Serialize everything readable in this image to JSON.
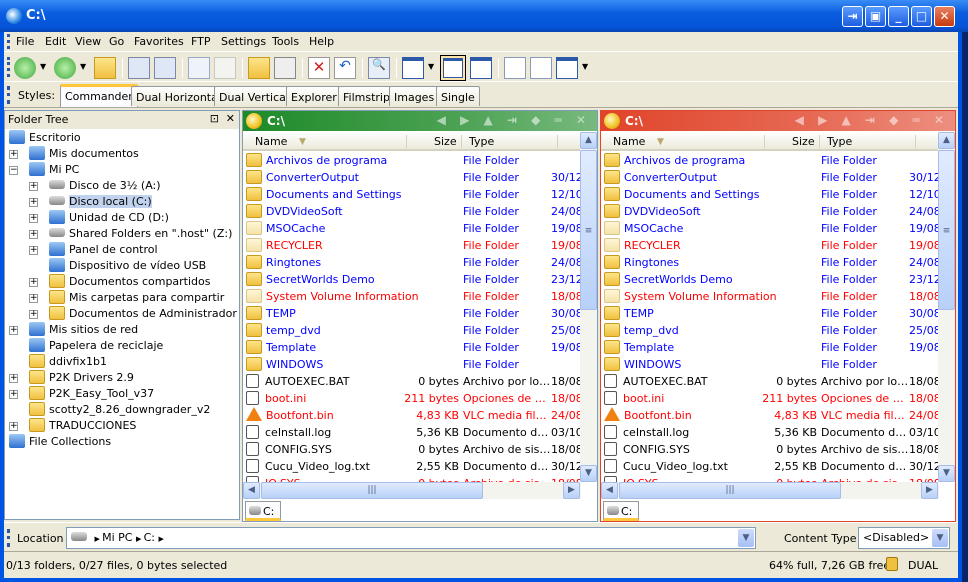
{
  "window": {
    "title": "C:\\"
  },
  "menu": [
    "File",
    "Edit",
    "View",
    "Go",
    "Favorites",
    "FTP",
    "Settings",
    "Tools",
    "Help"
  ],
  "styles": {
    "label": "Styles:",
    "tabs": [
      "Commander",
      "Dual Horizontal",
      "Dual Vertical",
      "Explorer",
      "Filmstrip",
      "Images",
      "Single"
    ],
    "active": "Commander"
  },
  "tree": {
    "title": "Folder Tree",
    "items": [
      {
        "label": "Escritorio",
        "level": 0,
        "exp": "",
        "icon": "desktop-icon"
      },
      {
        "label": "Mis documentos",
        "level": 1,
        "exp": "+",
        "icon": "documents-icon"
      },
      {
        "label": "Mi PC",
        "level": 1,
        "exp": "-",
        "icon": "computer-icon"
      },
      {
        "label": "Disco de 3½ (A:)",
        "level": 2,
        "exp": "+",
        "icon": "floppy-icon"
      },
      {
        "label": "Disco local (C:)",
        "level": 2,
        "exp": "+",
        "icon": "drive-icon",
        "selected": true
      },
      {
        "label": "Unidad de CD (D:)",
        "level": 2,
        "exp": "+",
        "icon": "cd-icon"
      },
      {
        "label": "Shared Folders en \".host\" (Z:)",
        "level": 2,
        "exp": "+",
        "icon": "network-drive-icon"
      },
      {
        "label": "Panel de control",
        "level": 2,
        "exp": "+",
        "icon": "control-panel-icon"
      },
      {
        "label": "Dispositivo de vídeo USB",
        "level": 2,
        "exp": "",
        "icon": "camera-icon"
      },
      {
        "label": "Documentos compartidos",
        "level": 2,
        "exp": "+",
        "icon": "folder-icon"
      },
      {
        "label": "Mis carpetas para compartir",
        "level": 2,
        "exp": "+",
        "icon": "shared-folder-icon"
      },
      {
        "label": "Documentos de Administrador",
        "level": 2,
        "exp": "+",
        "icon": "folder-icon"
      },
      {
        "label": "Mis sitios de red",
        "level": 1,
        "exp": "+",
        "icon": "network-icon"
      },
      {
        "label": "Papelera de reciclaje",
        "level": 1,
        "exp": "",
        "icon": "recycle-bin-icon"
      },
      {
        "label": "ddivfix1b1",
        "level": 1,
        "exp": "",
        "icon": "folder-icon"
      },
      {
        "label": "P2K Drivers 2.9",
        "level": 1,
        "exp": "+",
        "icon": "folder-icon"
      },
      {
        "label": "P2K_Easy_Tool_v37",
        "level": 1,
        "exp": "+",
        "icon": "folder-icon"
      },
      {
        "label": "scotty2_8.26_downgrader_v2",
        "level": 1,
        "exp": "",
        "icon": "folder-icon"
      },
      {
        "label": "TRADUCCIONES",
        "level": 1,
        "exp": "+",
        "icon": "folder-icon"
      },
      {
        "label": "File Collections",
        "level": 0,
        "exp": "",
        "icon": "collections-icon"
      }
    ]
  },
  "columns": {
    "name": "Name",
    "size": "Size",
    "type": "Type"
  },
  "panes": [
    {
      "title": "C:\\",
      "tab": "C:",
      "color": "#1e8a28"
    },
    {
      "title": "C:\\",
      "tab": "C:",
      "color": "#e0442a"
    }
  ],
  "files": [
    {
      "name": "Archivos de programa",
      "size": "",
      "type": "File Folder",
      "date": "",
      "kind": "folder",
      "color": "blue"
    },
    {
      "name": "ConverterOutput",
      "size": "",
      "type": "File Folder",
      "date": "30/12",
      "kind": "folder",
      "color": "blue"
    },
    {
      "name": "Documents and Settings",
      "size": "",
      "type": "File Folder",
      "date": "12/10",
      "kind": "folder",
      "color": "blue"
    },
    {
      "name": "DVDVideoSoft",
      "size": "",
      "type": "File Folder",
      "date": "24/08",
      "kind": "folder",
      "color": "blue"
    },
    {
      "name": "MSOCache",
      "size": "",
      "type": "File Folder",
      "date": "19/08",
      "kind": "folder-hidden",
      "color": "blue"
    },
    {
      "name": "RECYCLER",
      "size": "",
      "type": "File Folder",
      "date": "19/08",
      "kind": "folder-hidden",
      "color": "red"
    },
    {
      "name": "Ringtones",
      "size": "",
      "type": "File Folder",
      "date": "24/08",
      "kind": "folder",
      "color": "blue"
    },
    {
      "name": "SecretWorlds Demo",
      "size": "",
      "type": "File Folder",
      "date": "23/12",
      "kind": "folder",
      "color": "blue"
    },
    {
      "name": "System Volume Information",
      "size": "",
      "type": "File Folder",
      "date": "18/08",
      "kind": "folder-hidden",
      "color": "red"
    },
    {
      "name": "TEMP",
      "size": "",
      "type": "File Folder",
      "date": "30/08",
      "kind": "folder",
      "color": "blue"
    },
    {
      "name": "temp_dvd",
      "size": "",
      "type": "File Folder",
      "date": "25/08",
      "kind": "folder",
      "color": "blue"
    },
    {
      "name": "Template",
      "size": "",
      "type": "File Folder",
      "date": "19/08",
      "kind": "folder",
      "color": "blue"
    },
    {
      "name": "WINDOWS",
      "size": "",
      "type": "File Folder",
      "date": "",
      "kind": "folder",
      "color": "blue"
    },
    {
      "name": "AUTOEXEC.BAT",
      "size": "0 bytes",
      "type": "Archivo por lotes MS-DOS",
      "date": "18/08",
      "kind": "batch-file",
      "color": "black"
    },
    {
      "name": "boot.ini",
      "size": "211 bytes",
      "type": "Opciones de configuración",
      "date": "18/08",
      "kind": "ini-file",
      "color": "red"
    },
    {
      "name": "Bootfont.bin",
      "size": "4,83 KB",
      "type": "VLC media file (.bin)",
      "date": "24/08",
      "kind": "vlc-file",
      "color": "red"
    },
    {
      "name": "ceInstall.log",
      "size": "5,36 KB",
      "type": "Documento de texto",
      "date": "03/10",
      "kind": "text-file",
      "color": "black"
    },
    {
      "name": "CONFIG.SYS",
      "size": "0 bytes",
      "type": "Archivo de sistema",
      "date": "18/08",
      "kind": "sys-file",
      "color": "black"
    },
    {
      "name": "Cucu_Video_log.txt",
      "size": "2,55 KB",
      "type": "Documento de texto",
      "date": "30/12",
      "kind": "text-file",
      "color": "black"
    },
    {
      "name": "IO.SYS",
      "size": "0 bytes",
      "type": "Archivo de sistema",
      "date": "18/08",
      "kind": "sys-file",
      "color": "red"
    }
  ],
  "location": {
    "label": "Location",
    "path": [
      "Mi PC",
      "C:"
    ],
    "content_type_label": "Content Type",
    "content_type_value": "<Disabled>"
  },
  "status": {
    "selection": "0/13 folders, 0/27 files, 0 bytes selected",
    "disk": "64% full, 7,26 GB free",
    "mode": "DUAL"
  }
}
